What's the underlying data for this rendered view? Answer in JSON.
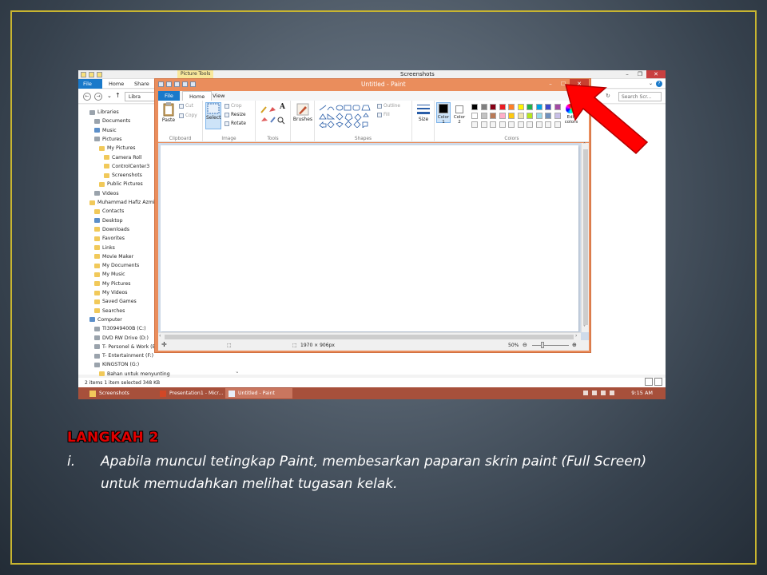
{
  "explorer": {
    "title": "Screenshots",
    "picture_tools": "Picture Tools",
    "tabs": [
      "File",
      "Home",
      "Share"
    ],
    "address_text": "Libra",
    "search_placeholder": "Search Scr...",
    "nav_items": [
      {
        "label": "Libraries",
        "indent": 0,
        "icon": "gray"
      },
      {
        "label": "Documents",
        "indent": 1,
        "icon": "gray"
      },
      {
        "label": "Music",
        "indent": 1,
        "icon": "blue"
      },
      {
        "label": "Pictures",
        "indent": 1,
        "icon": "gray"
      },
      {
        "label": "My Pictures",
        "indent": 2,
        "icon": "yellow"
      },
      {
        "label": "Camera Roll",
        "indent": 3,
        "icon": "yellow"
      },
      {
        "label": "ControlCenter3",
        "indent": 3,
        "icon": "yellow"
      },
      {
        "label": "Screenshots",
        "indent": 3,
        "icon": "yellow"
      },
      {
        "label": "Public Pictures",
        "indent": 2,
        "icon": "yellow"
      },
      {
        "label": "Videos",
        "indent": 1,
        "icon": "gray"
      },
      {
        "label": "Muhammad Hafiz Azmi",
        "indent": 0,
        "icon": "yellow"
      },
      {
        "label": "Contacts",
        "indent": 1,
        "icon": "yellow"
      },
      {
        "label": "Desktop",
        "indent": 1,
        "icon": "blue"
      },
      {
        "label": "Downloads",
        "indent": 1,
        "icon": "yellow"
      },
      {
        "label": "Favorites",
        "indent": 1,
        "icon": "yellow"
      },
      {
        "label": "Links",
        "indent": 1,
        "icon": "yellow"
      },
      {
        "label": "Movie Maker",
        "indent": 1,
        "icon": "yellow"
      },
      {
        "label": "My Documents",
        "indent": 1,
        "icon": "yellow"
      },
      {
        "label": "My Music",
        "indent": 1,
        "icon": "yellow"
      },
      {
        "label": "My Pictures",
        "indent": 1,
        "icon": "yellow"
      },
      {
        "label": "My Videos",
        "indent": 1,
        "icon": "yellow"
      },
      {
        "label": "Saved Games",
        "indent": 1,
        "icon": "yellow"
      },
      {
        "label": "Searches",
        "indent": 1,
        "icon": "yellow"
      },
      {
        "label": "Computer",
        "indent": 0,
        "icon": "blue"
      },
      {
        "label": "TI30949400B (C:)",
        "indent": 1,
        "icon": "gray"
      },
      {
        "label": "DVD RW Drive (D:)",
        "indent": 1,
        "icon": "gray"
      },
      {
        "label": "T- Personel & Work (E:",
        "indent": 1,
        "icon": "gray"
      },
      {
        "label": "T- Entertainment (F:)",
        "indent": 1,
        "icon": "gray"
      },
      {
        "label": "KINGSTON (G:)",
        "indent": 1,
        "icon": "gray"
      },
      {
        "label": "Bahan untuk menyunting",
        "indent": 2,
        "icon": "yellow"
      }
    ],
    "status": "2 items     1 item selected  348 KB"
  },
  "paint": {
    "title": "Untitled - Paint",
    "tabs": [
      "File",
      "Home",
      "View"
    ],
    "clipboard": {
      "paste": "Paste",
      "cut": "Cut",
      "copy": "Copy",
      "label": "Clipboard"
    },
    "image": {
      "select": "Select",
      "crop": "Crop",
      "resize": "Resize",
      "rotate": "Rotate",
      "label": "Image"
    },
    "tools": {
      "label": "Tools",
      "text_tool": "A"
    },
    "brushes": "Brushes",
    "shapes": {
      "outline": "Outline",
      "fill": "Fill",
      "label": "Shapes"
    },
    "size": "Size",
    "color1": "Color 1",
    "color2": "Color 2",
    "colors_label": "Colors",
    "edit_colors": "Edit colors",
    "palette_row1": [
      "#000000",
      "#7f7f7f",
      "#880015",
      "#ed1c24",
      "#ff7f27",
      "#fff200",
      "#22b14c",
      "#00a2e8",
      "#3f48cc",
      "#a349a4"
    ],
    "palette_row2": [
      "#ffffff",
      "#c3c3c3",
      "#b97a57",
      "#ffaec9",
      "#ffc90e",
      "#efe4b0",
      "#b5e61d",
      "#99d9ea",
      "#7092be",
      "#c8bfe7"
    ],
    "image_size": "1970 × 906px",
    "zoom": "50%"
  },
  "taskbar": {
    "items": [
      "Screenshots",
      "Presentation1 - Micr...",
      "Untitled - Paint"
    ],
    "time": "9:15 AM"
  },
  "caption": {
    "step": "LANGKAH 2",
    "number": "i.",
    "text": "Apabila muncul tetingkap Paint, membesarkan paparan skrin paint (Full Screen) untuk memudahkan melihat tugasan kelak."
  },
  "colors": {
    "slide_border": "#c8b530",
    "paint_frame": "#ea8d5c",
    "taskbar": "#a7503b",
    "arrow": "#ff0000",
    "step_text": "#e00000"
  }
}
